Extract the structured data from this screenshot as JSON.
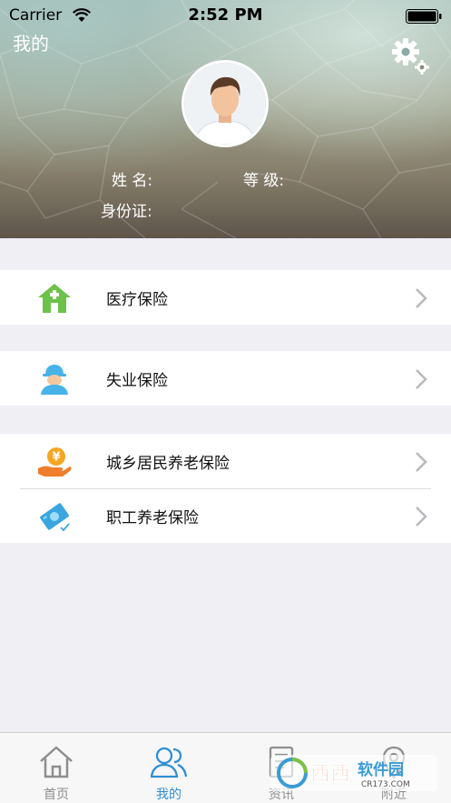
{
  "status_bar": {
    "carrier": "Carrier",
    "time": "2:52 PM"
  },
  "header": {
    "title": "我的",
    "name_label": "姓 名:",
    "level_label": "等 级:",
    "id_label": "身份证:"
  },
  "menu": {
    "groups": [
      {
        "items": [
          {
            "label": "医疗保险",
            "icon": "house-plus-icon"
          }
        ]
      },
      {
        "items": [
          {
            "label": "失业保险",
            "icon": "worker-icon"
          }
        ]
      },
      {
        "items": [
          {
            "label": "城乡居民养老保险",
            "icon": "yuan-hand-icon"
          },
          {
            "label": "职工养老保险",
            "icon": "card-check-icon"
          }
        ]
      }
    ]
  },
  "tabbar": {
    "tabs": [
      {
        "label": "首页",
        "icon": "home-icon"
      },
      {
        "label": "我的",
        "icon": "people-icon",
        "active": true
      },
      {
        "label": "资讯",
        "icon": "news-icon"
      },
      {
        "label": "附近",
        "icon": "location-pin-icon"
      }
    ]
  },
  "watermark": {
    "text": "西西软件园",
    "sub": "CR173.COM"
  },
  "colors": {
    "accent": "#2f8fd6",
    "medical_green": "#6cc24a",
    "worker_blue": "#47b3e8",
    "yuan_orange": "#f5a623"
  }
}
